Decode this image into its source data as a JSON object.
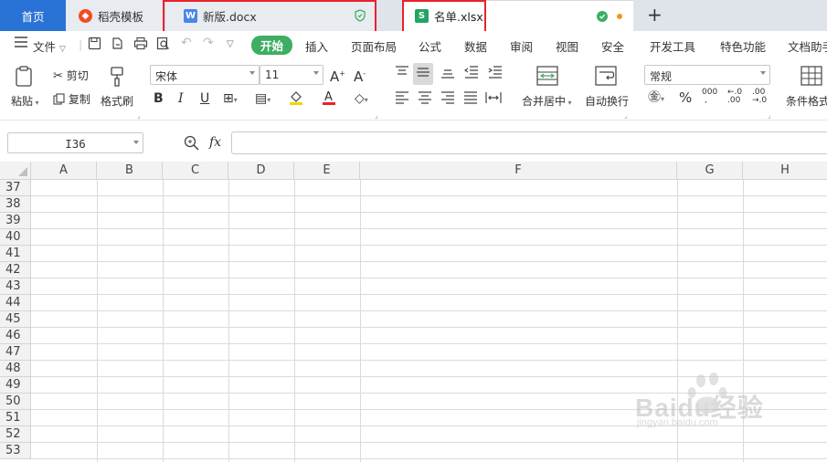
{
  "tabs": {
    "home": "首页",
    "template": "稻壳模板",
    "doc": "新版.docx",
    "sheet": "名单.xlsx"
  },
  "menu": {
    "file": "文件",
    "start": "开始",
    "items": [
      "插入",
      "页面布局",
      "公式",
      "数据",
      "审阅",
      "视图",
      "安全",
      "开发工具",
      "特色功能",
      "文档助手"
    ]
  },
  "toolbar": {
    "paste": "粘贴",
    "cut": "剪切",
    "copy": "复制",
    "format_painter": "格式刷",
    "font_name": "宋体",
    "font_size": "11",
    "merge_center": "合并居中",
    "wrap_text": "自动换行",
    "number_format": "常规",
    "conditional_format": "条件格式"
  },
  "formula": {
    "cell_ref": "I36",
    "fx": "fx",
    "value": ""
  },
  "columns": [
    "A",
    "B",
    "C",
    "D",
    "E",
    "F",
    "G",
    "H"
  ],
  "rows": [
    "37",
    "38",
    "39",
    "40",
    "41",
    "42",
    "43",
    "44",
    "45",
    "46",
    "47",
    "48",
    "49",
    "50",
    "51",
    "52",
    "53"
  ],
  "watermark": {
    "brand": "Baidu经验",
    "url": "jingyan.baidu.com"
  },
  "colors": {
    "accent_blue": "#2a73d6",
    "start_green": "#3dae63",
    "highlight_red": "#e8232a"
  }
}
